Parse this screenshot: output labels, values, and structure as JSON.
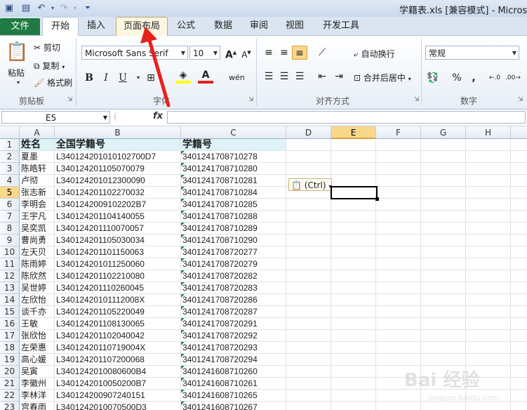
{
  "window": {
    "title": "学籍表.xls  [兼容模式] - Microso"
  },
  "quick_access": {
    "save_icon": "save-icon",
    "undo_icon": "undo-icon",
    "redo_icon": "redo-icon",
    "customize_icon": "customize-icon"
  },
  "tabs": [
    {
      "label": "文件"
    },
    {
      "label": "开始"
    },
    {
      "label": "插入"
    },
    {
      "label": "页面布局"
    },
    {
      "label": "公式"
    },
    {
      "label": "数据"
    },
    {
      "label": "审阅"
    },
    {
      "label": "视图"
    },
    {
      "label": "开发工具"
    }
  ],
  "ribbon": {
    "clipboard": {
      "paste": "粘贴",
      "cut": "剪切",
      "copy": "复制",
      "format_painter": "格式刷",
      "label": "剪贴板"
    },
    "font": {
      "name": "Microsoft Sans Serif",
      "size": "10",
      "bold": "B",
      "italic": "I",
      "underline": "U",
      "label": "字体"
    },
    "alignment": {
      "wrap": "自动换行",
      "merge": "合并后居中",
      "label": "对齐方式"
    },
    "number": {
      "format": "常规",
      "percent": "%",
      "comma": ",",
      "label": "数字"
    }
  },
  "formula_bar": {
    "name_box": "E5",
    "fx": "fx",
    "formula": ""
  },
  "grid": {
    "columns": [
      "A",
      "B",
      "C",
      "D",
      "E",
      "F",
      "G",
      "H"
    ],
    "selected_column": "E",
    "selected_row": "5",
    "rows": [
      {
        "n": "1",
        "a": "姓名",
        "b": "全国学籍号",
        "c": "学籍号"
      },
      {
        "n": "2",
        "a": "夏墨",
        "b": "L340124201010102700D7",
        "c": "340124170871027 8"
      },
      {
        "n": "3",
        "a": "陈皓轩",
        "b": "L340124201105070079",
        "c": "340124170871028 0"
      },
      {
        "n": "4",
        "a": "卢彻",
        "b": "L340124201012300090",
        "c": "340124170871028 1"
      },
      {
        "n": "5",
        "a": "张志新",
        "b": "L340124201102270032",
        "c": "340124170871028 4"
      },
      {
        "n": "6",
        "a": "李明会",
        "b": "L34012420091022 02B7",
        "c": "340124170871028 5"
      },
      {
        "n": "7",
        "a": "王宇凡",
        "b": "L340124201104140055",
        "c": "340124170871028 8"
      },
      {
        "n": "8",
        "a": "吴奕凯",
        "b": "L340124201110070057",
        "c": "340124170871028 9"
      },
      {
        "n": "9",
        "a": "曹尚勇",
        "b": "L340124201105030034",
        "c": "340124170871029 0"
      },
      {
        "n": "10",
        "a": "左天贝",
        "b": "L340124201101150063",
        "c": "340124170872027 7"
      },
      {
        "n": "11",
        "a": "陈雨婷",
        "b": "L340124201011250060",
        "c": "340124170872027 9"
      },
      {
        "n": "12",
        "a": "陈欣然",
        "b": "L340124201102210080",
        "c": "340124170872028 2"
      },
      {
        "n": "13",
        "a": "吴世婷",
        "b": "L340124201110260045",
        "c": "340124170872028 3"
      },
      {
        "n": "14",
        "a": "左欣怡",
        "b": "L34012420101112008X",
        "c": "340124170872028 6"
      },
      {
        "n": "15",
        "a": "谈千亦",
        "b": "L340124201105220049",
        "c": "340124170872028 7"
      },
      {
        "n": "16",
        "a": "王敏",
        "b": "L340124201108130065",
        "c": "340124170872029 1"
      },
      {
        "n": "17",
        "a": "张欣怡",
        "b": "L340124201102040042",
        "c": "340124170872029 2"
      },
      {
        "n": "18",
        "a": "左荣惠",
        "b": "L34012420110719004X",
        "c": "340124170872029 3"
      },
      {
        "n": "19",
        "a": "高心媛",
        "b": "L340124201107200068",
        "c": "340124170872029 4"
      },
      {
        "n": "20",
        "a": "吴寅",
        "b": "L34012420100806 00B4",
        "c": "340124160871026 0"
      },
      {
        "n": "21",
        "a": "李徽州",
        "b": "L34012420100502 00B7",
        "c": "340124160871026 1"
      },
      {
        "n": "22",
        "a": "李林洋",
        "b": "L340124200907240151",
        "c": "340124160871026 5"
      },
      {
        "n": "23",
        "a": "宫春雨",
        "b": "L34012420100705 00D3",
        "c": "340124160871026 7"
      }
    ]
  },
  "paste_options": {
    "label": "(Ctrl)"
  },
  "watermark": {
    "text": "Bai 经验",
    "sub": "jingyan.baidu.com"
  }
}
